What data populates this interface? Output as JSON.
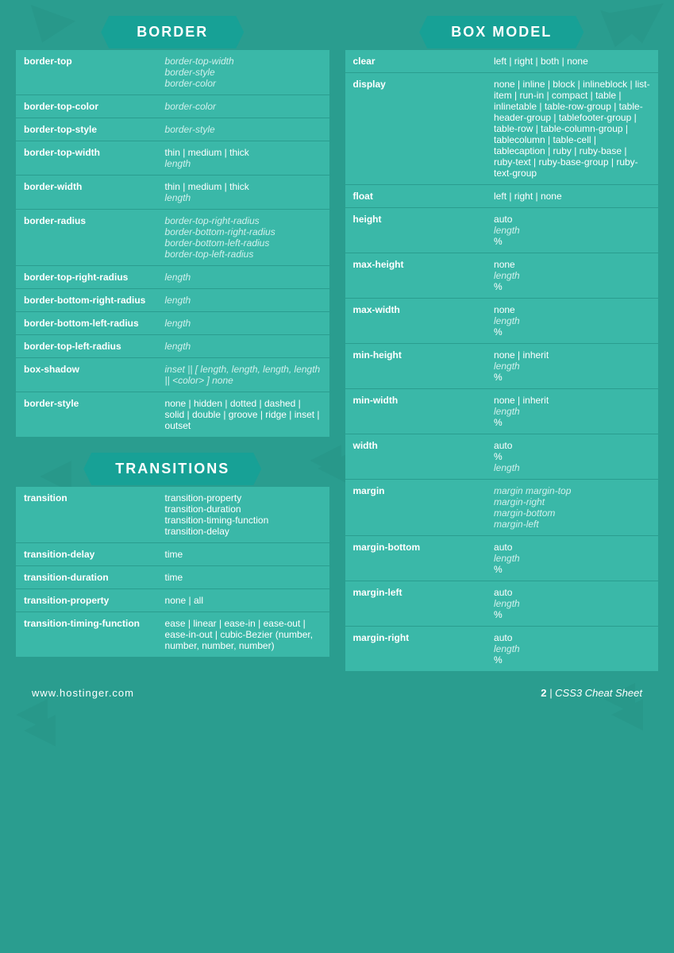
{
  "border_section": {
    "title": "BORDER",
    "rows": [
      {
        "property": "border-top",
        "values": [
          {
            "text": "border-top-width",
            "italic": true
          },
          {
            "text": "border-style",
            "italic": true
          },
          {
            "text": "border-color",
            "italic": true
          }
        ]
      },
      {
        "property": "border-top-color",
        "values": [
          {
            "text": "border-color",
            "italic": true
          }
        ]
      },
      {
        "property": "border-top-style",
        "values": [
          {
            "text": "border-style",
            "italic": true
          }
        ]
      },
      {
        "property": "border-top-width",
        "values": [
          {
            "text": "thin | medium | thick",
            "italic": false
          },
          {
            "text": "length",
            "italic": true
          }
        ]
      },
      {
        "property": "border-width",
        "values": [
          {
            "text": "thin | medium | thick",
            "italic": false
          },
          {
            "text": "length",
            "italic": true
          }
        ]
      },
      {
        "property": "border-radius",
        "values": [
          {
            "text": "border-top-right-radius",
            "italic": true
          },
          {
            "text": "border-bottom-right-radius",
            "italic": true
          },
          {
            "text": "border-bottom-left-radius",
            "italic": true
          },
          {
            "text": "border-top-left-radius",
            "italic": true
          }
        ]
      },
      {
        "property": "border-top-right-radius",
        "values": [
          {
            "text": "length",
            "italic": true
          }
        ]
      },
      {
        "property": "border-bottom-right-radius",
        "values": [
          {
            "text": "length",
            "italic": true
          }
        ]
      },
      {
        "property": "border-bottom-left-radius",
        "values": [
          {
            "text": "length",
            "italic": true
          }
        ]
      },
      {
        "property": "border-top-left-radius",
        "values": [
          {
            "text": "length",
            "italic": true
          }
        ]
      },
      {
        "property": "box-shadow",
        "values": [
          {
            "text": "inset || [ length, length, length, length || <color> ] none",
            "italic": true
          }
        ]
      },
      {
        "property": "border-style",
        "values": [
          {
            "text": "none | hidden | dotted | dashed | solid | double | groove | ridge | inset | outset",
            "italic": false
          }
        ]
      }
    ]
  },
  "box_model_section": {
    "title": "BOX MODEL",
    "rows": [
      {
        "property": "clear",
        "values": [
          {
            "text": "left | right | both | none",
            "italic": false
          }
        ]
      },
      {
        "property": "display",
        "values": [
          {
            "text": "none | inline | block | inlineblock | list-item | run-in | compact | table | inlinetable | table-row-group | table-header-group | tablefooter-group | table-row | table-column-group | tablecolumn | table-cell | tablecaption | ruby | ruby-base | ruby-text | ruby-base-group | ruby-text-group",
            "italic": false
          }
        ]
      },
      {
        "property": "float",
        "values": [
          {
            "text": "left | right | none",
            "italic": false
          }
        ]
      },
      {
        "property": "height",
        "values": [
          {
            "text": "auto",
            "italic": false
          },
          {
            "text": "length",
            "italic": true
          },
          {
            "text": "%",
            "italic": false
          }
        ]
      },
      {
        "property": "max-height",
        "values": [
          {
            "text": "none",
            "italic": false
          },
          {
            "text": "length",
            "italic": true
          },
          {
            "text": "%",
            "italic": false
          }
        ]
      },
      {
        "property": "max-width",
        "values": [
          {
            "text": "none",
            "italic": false
          },
          {
            "text": "length",
            "italic": true
          },
          {
            "text": "%",
            "italic": false
          }
        ]
      },
      {
        "property": "min-height",
        "values": [
          {
            "text": "none | inherit",
            "italic": false
          },
          {
            "text": "length",
            "italic": true
          },
          {
            "text": "%",
            "italic": false
          }
        ]
      },
      {
        "property": "min-width",
        "values": [
          {
            "text": "none | inherit",
            "italic": false
          },
          {
            "text": "length",
            "italic": true
          },
          {
            "text": "%",
            "italic": false
          }
        ]
      },
      {
        "property": "width",
        "values": [
          {
            "text": "auto",
            "italic": false
          },
          {
            "text": "%",
            "italic": false
          },
          {
            "text": "length",
            "italic": true
          }
        ]
      },
      {
        "property": "margin",
        "values": [
          {
            "text": "margin margin-top",
            "italic": true
          },
          {
            "text": "margin-right",
            "italic": true
          },
          {
            "text": "margin-bottom",
            "italic": true
          },
          {
            "text": "margin-left",
            "italic": true
          }
        ]
      },
      {
        "property": "margin-bottom",
        "values": [
          {
            "text": "auto",
            "italic": false
          },
          {
            "text": "length",
            "italic": true
          },
          {
            "text": "%",
            "italic": false
          }
        ]
      },
      {
        "property": "margin-left",
        "values": [
          {
            "text": "auto",
            "italic": false
          },
          {
            "text": "length",
            "italic": true
          },
          {
            "text": "%",
            "italic": false
          }
        ]
      },
      {
        "property": "margin-right",
        "values": [
          {
            "text": "auto",
            "italic": false
          },
          {
            "text": "length",
            "italic": true
          },
          {
            "text": "%",
            "italic": false
          }
        ]
      }
    ]
  },
  "transitions_section": {
    "title": "TRANSITIONS",
    "rows": [
      {
        "property": "transition",
        "values": [
          {
            "text": "transition-property",
            "italic": false
          },
          {
            "text": "transition-duration",
            "italic": false
          },
          {
            "text": "transition-timing-function",
            "italic": false
          },
          {
            "text": "transition-delay",
            "italic": false
          }
        ]
      },
      {
        "property": "transition-delay",
        "values": [
          {
            "text": "time",
            "italic": false
          }
        ]
      },
      {
        "property": "transition-duration",
        "values": [
          {
            "text": "time",
            "italic": false
          }
        ]
      },
      {
        "property": "transition-property",
        "values": [
          {
            "text": "none | all",
            "italic": false
          }
        ]
      },
      {
        "property": "transition-timing-function",
        "values": [
          {
            "text": "ease | linear | ease-in | ease-out | ease-in-out | cubic-Bezier (number, number, number, number)",
            "italic": false
          }
        ]
      }
    ]
  },
  "footer": {
    "website": "www.hostinger.com",
    "page_number": "2",
    "page_label": "CSS3 Cheat Sheet"
  }
}
